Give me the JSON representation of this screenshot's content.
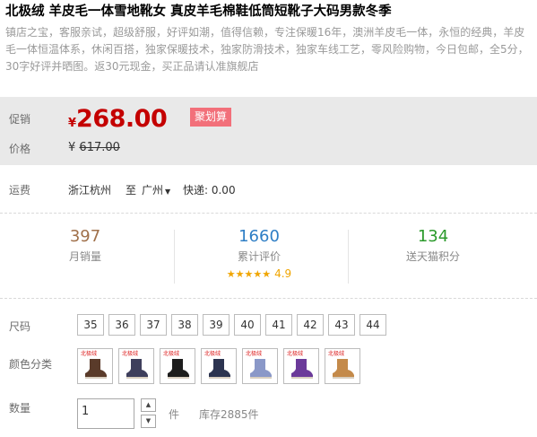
{
  "product": {
    "title": "北极绒 羊皮毛一体雪地靴女 真皮羊毛棉鞋低筒短靴子大码男款冬季",
    "subtitle": "镇店之宝，客服亲试，超级舒服，好评如潮，值得信赖，专注保暖16年，澳洲羊皮毛一体，永恒的经典，羊皮毛一体恒温体系，休闲百搭，独家保暖技术，独家防滑技术，独家车线工艺，零风险购物，今日包邮，全5分，30字好评并晒图。返30元现金，买正品请认准旗舰店"
  },
  "pricing": {
    "promo_label": "促销",
    "currency": "¥",
    "promo_price": "268.00",
    "promo_tag": "聚划算",
    "price_label": "价格",
    "original_price": "617.00"
  },
  "shipping": {
    "label": "运费",
    "from": "浙江杭州",
    "to_word": "至",
    "to": "广州",
    "express": "快递: 0.00"
  },
  "stats": {
    "monthly_sales": "397",
    "monthly_sales_label": "月销量",
    "reviews": "1660",
    "reviews_label": "累计评价",
    "rating": "4.9",
    "rating_stars": "★★★★★",
    "points": "134",
    "points_label": "送天猫积分"
  },
  "colors": {
    "price_red": "#c40000",
    "tag_pink": "#f2707a",
    "sales_brown": "#a0704a",
    "reviews_blue": "#2e7ec5",
    "points_green": "#2b9a2b"
  },
  "options": {
    "size_label": "尺码",
    "sizes": [
      "35",
      "36",
      "37",
      "38",
      "39",
      "40",
      "41",
      "42",
      "43",
      "44"
    ],
    "color_label": "颜色分类",
    "swatch_mini_text": "北极绒",
    "swatches": [
      "brown-boot",
      "navy-boot",
      "black-boot",
      "dark-blue-boot",
      "light-blue-boot",
      "purple-boot",
      "chestnut-boot"
    ],
    "swatch_colors": [
      "#5a3b2a",
      "#3e3f5c",
      "#1d1d1d",
      "#2c3450",
      "#8a98c8",
      "#6b3a9a",
      "#c48a4a"
    ]
  },
  "quantity": {
    "label": "数量",
    "value": "1",
    "unit": "件",
    "stock": "库存2885件"
  }
}
